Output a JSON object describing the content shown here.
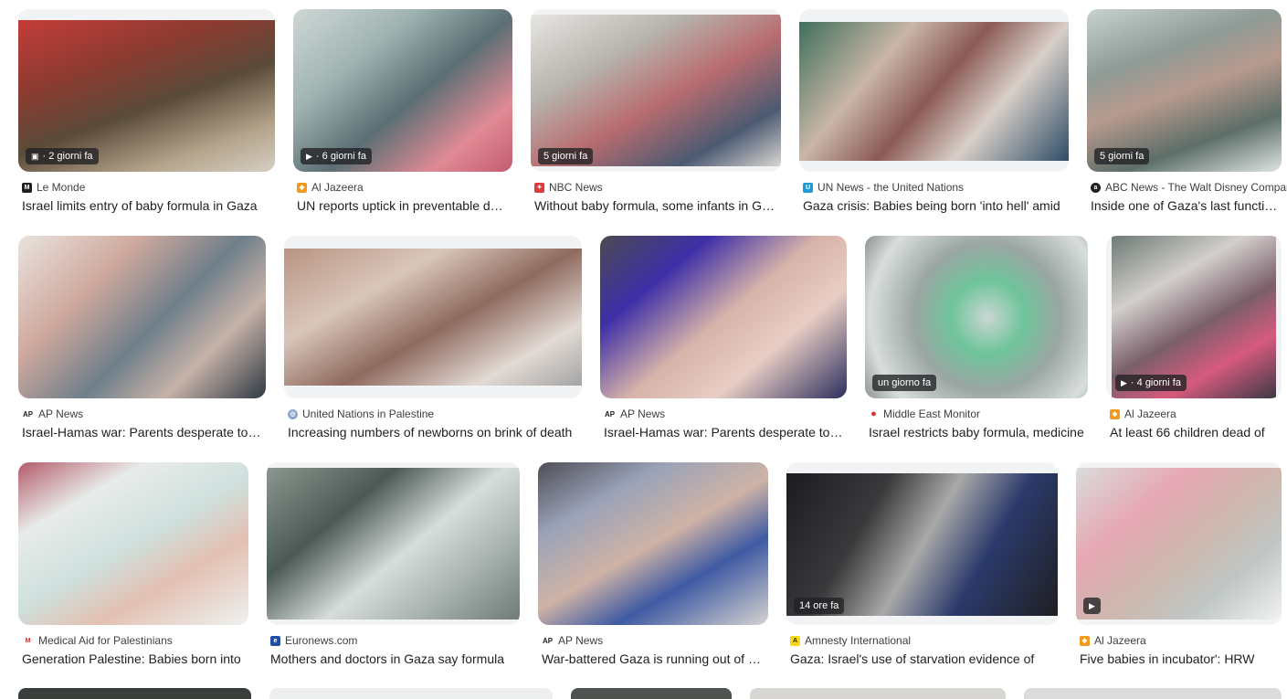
{
  "results": [
    {
      "source": "Le Monde",
      "title": "Israel limits entry of baby formula in Gaza",
      "badge": "· 2 giorni fa",
      "badge_icon": "image-icon",
      "favicon_color": "#202124",
      "favicon_char": "M"
    },
    {
      "source": "Al Jazeera",
      "title": "UN reports uptick in preventable deaths in Gaza",
      "badge": "· 6 giorni fa",
      "badge_icon": "play-icon",
      "favicon_color": "#f39a1e",
      "favicon_char": "◆"
    },
    {
      "source": "NBC News",
      "title": "Without baby formula, some infants in Gaza",
      "badge": "5 giorni fa",
      "badge_icon": "",
      "favicon_color": "#e03a3e",
      "favicon_char": "✦"
    },
    {
      "source": "UN News - the United Nations",
      "title": "Gaza crisis: Babies being born 'into hell' amid",
      "badge": "",
      "badge_icon": "",
      "favicon_color": "#1e9bd7",
      "favicon_char": "U"
    },
    {
      "source": "ABC News - The Walt Disney Company",
      "title": "Inside one of Gaza's last functioning hospitals",
      "badge": "5 giorni fa",
      "badge_icon": "",
      "favicon_color": "#202124",
      "favicon_char": "a"
    },
    {
      "source": "AP News",
      "title": "Israel-Hamas war: Parents desperate to feed",
      "badge": "",
      "badge_icon": "",
      "favicon_color": "#202124",
      "favicon_char": "AP"
    },
    {
      "source": "United Nations in Palestine",
      "title": "Increasing numbers of newborns on brink of death",
      "badge": "",
      "badge_icon": "",
      "favicon_color": "#8aa6cc",
      "favicon_char": "◎"
    },
    {
      "source": "AP News",
      "title": "Israel-Hamas war: Parents desperate to feed",
      "badge": "",
      "badge_icon": "",
      "favicon_color": "#202124",
      "favicon_char": "AP"
    },
    {
      "source": "Middle East Monitor",
      "title": "Israel restricts baby formula, medicine",
      "badge": "un giorno fa",
      "badge_icon": "",
      "favicon_color": "#d32f2f",
      "favicon_char": "●"
    },
    {
      "source": "Al Jazeera",
      "title": "At least 66 children dead of",
      "badge": "· 4 giorni fa",
      "badge_icon": "play-icon",
      "favicon_color": "#f39a1e",
      "favicon_char": "◆"
    },
    {
      "source": "Medical Aid for Palestinians",
      "title": "Generation Palestine: Babies born into",
      "badge": "",
      "badge_icon": "",
      "favicon_color": "#d32f2f",
      "favicon_char": "M"
    },
    {
      "source": "Euronews.com",
      "title": "Mothers and doctors in Gaza say formula",
      "badge": "",
      "badge_icon": "",
      "favicon_color": "#1f4fa3",
      "favicon_char": "e"
    },
    {
      "source": "AP News",
      "title": "War-battered Gaza is running out of baby",
      "badge": "",
      "badge_icon": "",
      "favicon_color": "#202124",
      "favicon_char": "AP"
    },
    {
      "source": "Amnesty International",
      "title": "Gaza: Israel's use of starvation evidence of",
      "badge": "14 ore fa",
      "badge_icon": "",
      "favicon_color": "#f7d90f",
      "favicon_char": "A"
    },
    {
      "source": "Al Jazeera",
      "title": "Five babies in incubator': HRW",
      "badge": "",
      "badge_icon": "play-only",
      "favicon_color": "#f39a1e",
      "favicon_char": "◆"
    }
  ]
}
